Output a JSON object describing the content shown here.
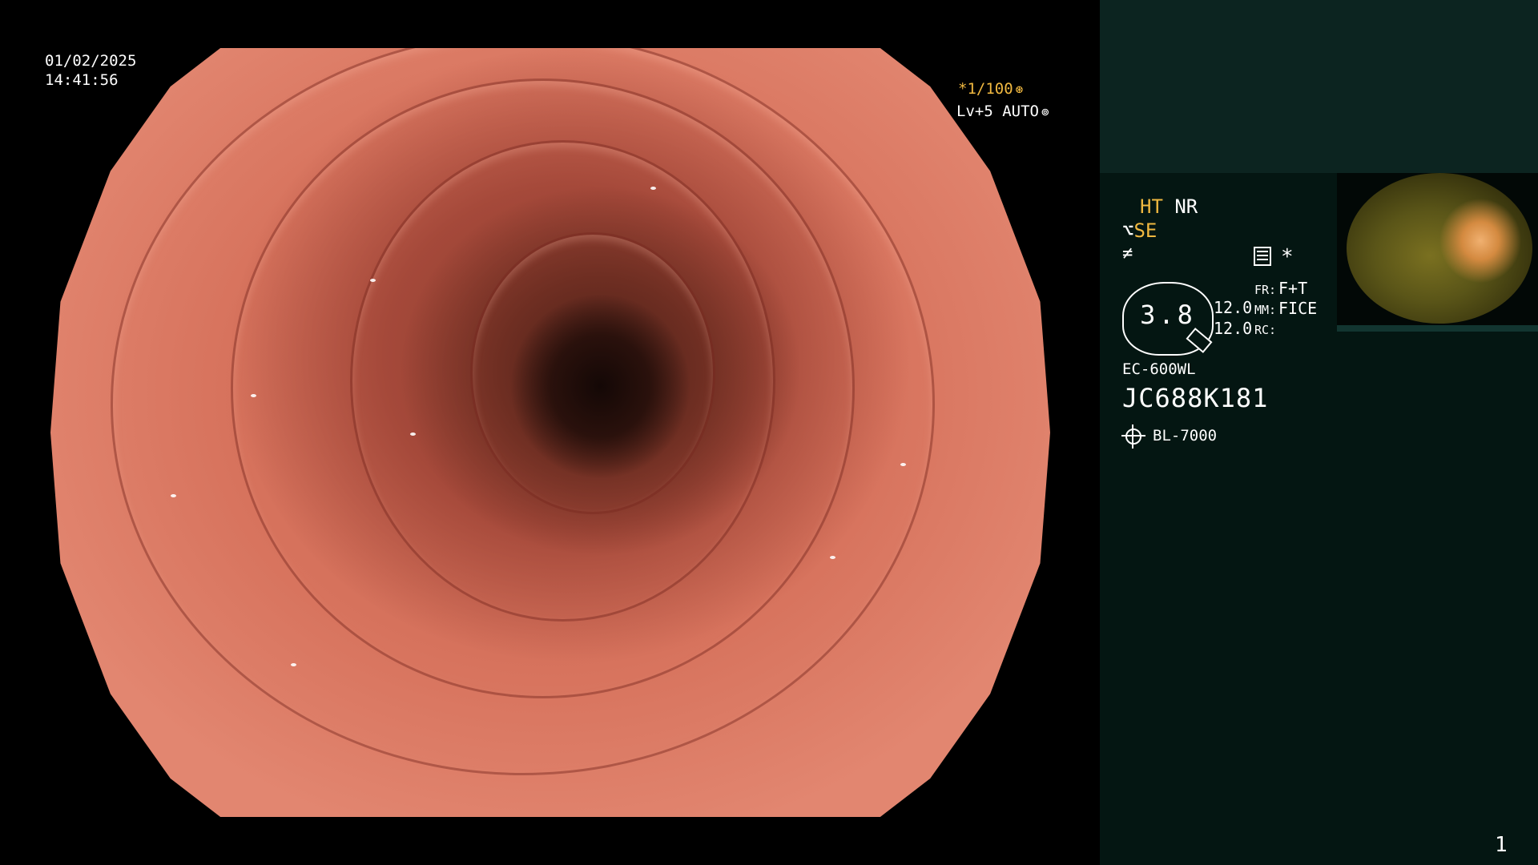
{
  "osd": {
    "date": "01/02/2025",
    "time": "14:41:56",
    "shutter": "*1/100",
    "level": "Lv+5 AUTO"
  },
  "panel": {
    "ht_label": "HT",
    "nr_label": "NR",
    "se_label": "SE",
    "gauge_value": "3.8",
    "enh_value_1": "12.0",
    "enh_value_2": "12.0",
    "fr_label": "FR:",
    "fr_value": "F+T",
    "mm_label": "MM:",
    "mm_value": "FICE",
    "rc_label": "RC:",
    "scope_model": "EC-600WL",
    "scope_serial": "JC688K181",
    "light_source": "BL-7000",
    "star": "*"
  },
  "page_number": "1",
  "colors": {
    "accent_yellow": "#f0b840",
    "panel_bg": "#041612",
    "panel_top": "#0c2420"
  }
}
